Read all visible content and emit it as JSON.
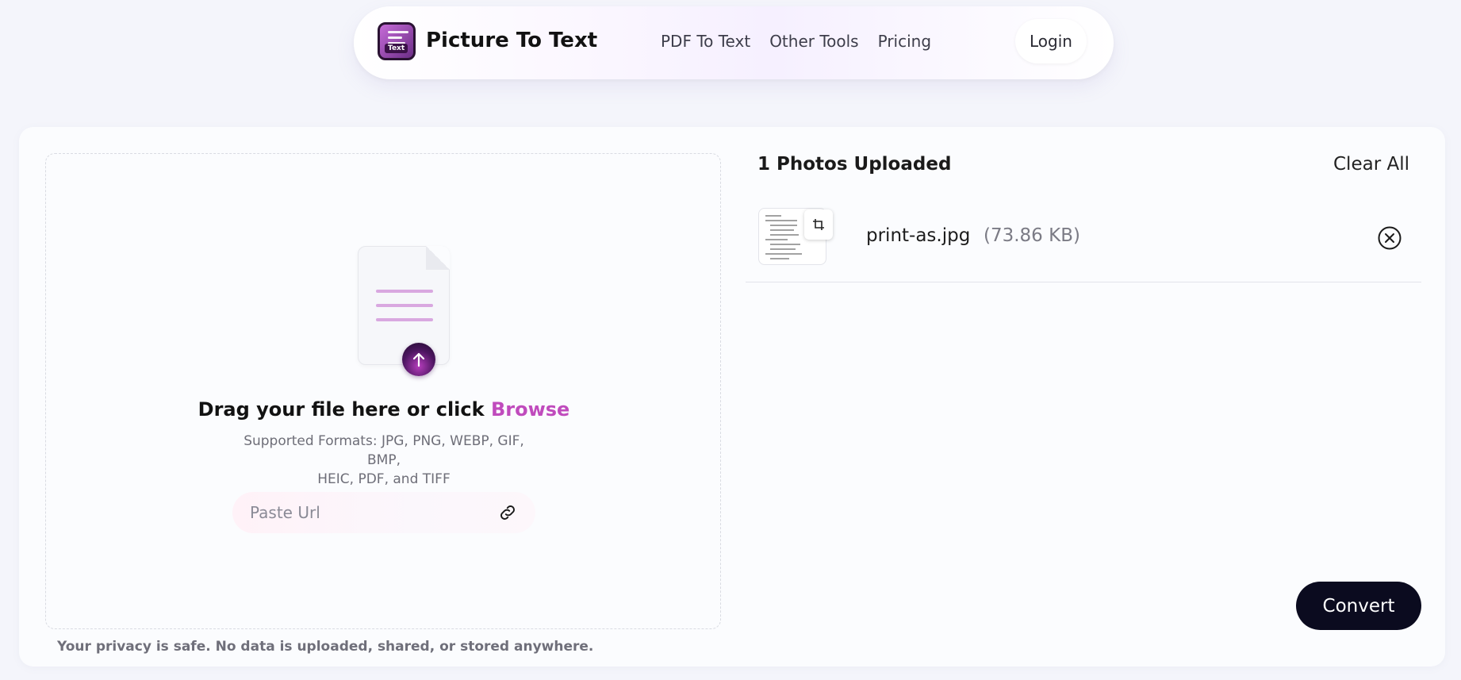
{
  "header": {
    "brand": "Picture To Text",
    "logo_badge": "Text",
    "nav": [
      "PDF To Text",
      "Other Tools",
      "Pricing"
    ],
    "login_label": "Login"
  },
  "upload": {
    "drag_prefix": "Drag your file here or click",
    "browse_label": "Browse",
    "formats_line1": "Supported Formats: JPG, PNG, WEBP, GIF, BMP,",
    "formats_line2": "HEIC, PDF, and TIFF",
    "url_placeholder": "Paste Url",
    "privacy": "Your privacy is safe. No data is uploaded, shared, or stored anywhere."
  },
  "files": {
    "title": "1 Photos Uploaded",
    "clear_all": "Clear All",
    "items": [
      {
        "name": "print-as.jpg",
        "size": "(73.86 KB)"
      }
    ]
  },
  "actions": {
    "convert_label": "Convert"
  },
  "colors": {
    "accent": "#c04bbd",
    "convert_bg": "#0b0b1f"
  },
  "icons": [
    "app-logo-icon",
    "document-icon",
    "upload-arrow-icon",
    "link-icon",
    "crop-icon",
    "close-circle-icon"
  ]
}
